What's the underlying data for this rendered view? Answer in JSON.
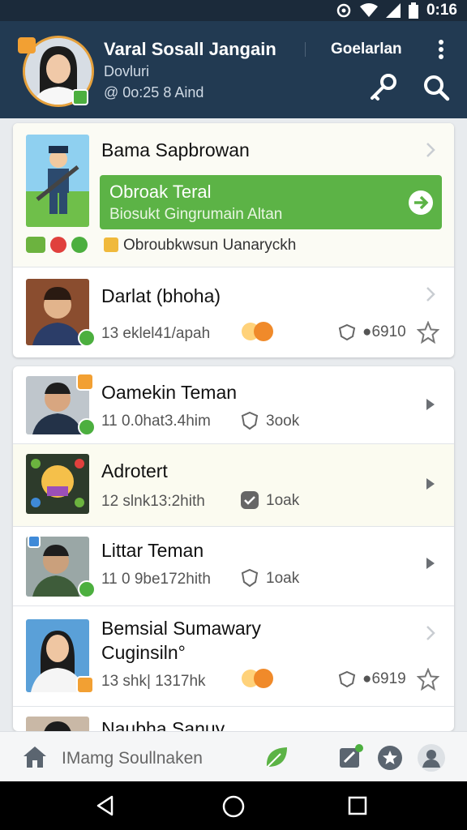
{
  "status_bar": {
    "time": "0:16"
  },
  "header": {
    "name": "Varal Sosall Jangain",
    "subtitle": "Dovluri",
    "timestamp": "@ 0o:25 8 Aind",
    "action_label": "Goelarlan"
  },
  "featured": {
    "title": "Bama Sapbrowan",
    "promo_title": "Obroak Teral",
    "promo_subtitle": "Biosukt Gingrumain Altan",
    "tag_description": "Obroubkwsun Uanaryckh"
  },
  "list_card_1": [
    {
      "title": "Darlat (bhoha)",
      "meta": "13 eklel41/apah",
      "stat": "6910"
    }
  ],
  "list_card_2": [
    {
      "title": "Oamekin Teman",
      "meta": "11 0.0hat3.4him",
      "stat": "3ook"
    },
    {
      "title": "Adrotert",
      "meta": "12 slnk13:2hith",
      "stat": "1oak"
    },
    {
      "title": "Littar Teman",
      "meta": "11 0 9be172hith",
      "stat": "1oak"
    },
    {
      "title": "Bemsial Sumawary",
      "title2": "Cuginsiln°",
      "meta": "13 shk| 1317hk",
      "stat": "6919"
    },
    {
      "title": "Naubha Sanuy"
    }
  ],
  "bottom_nav": {
    "search_label": "IMamg Soullnaken"
  },
  "colors": {
    "header": "#223a52",
    "accent_green": "#5cb346",
    "badge_green": "#4caf3f",
    "badge_orange": "#f2a033"
  }
}
